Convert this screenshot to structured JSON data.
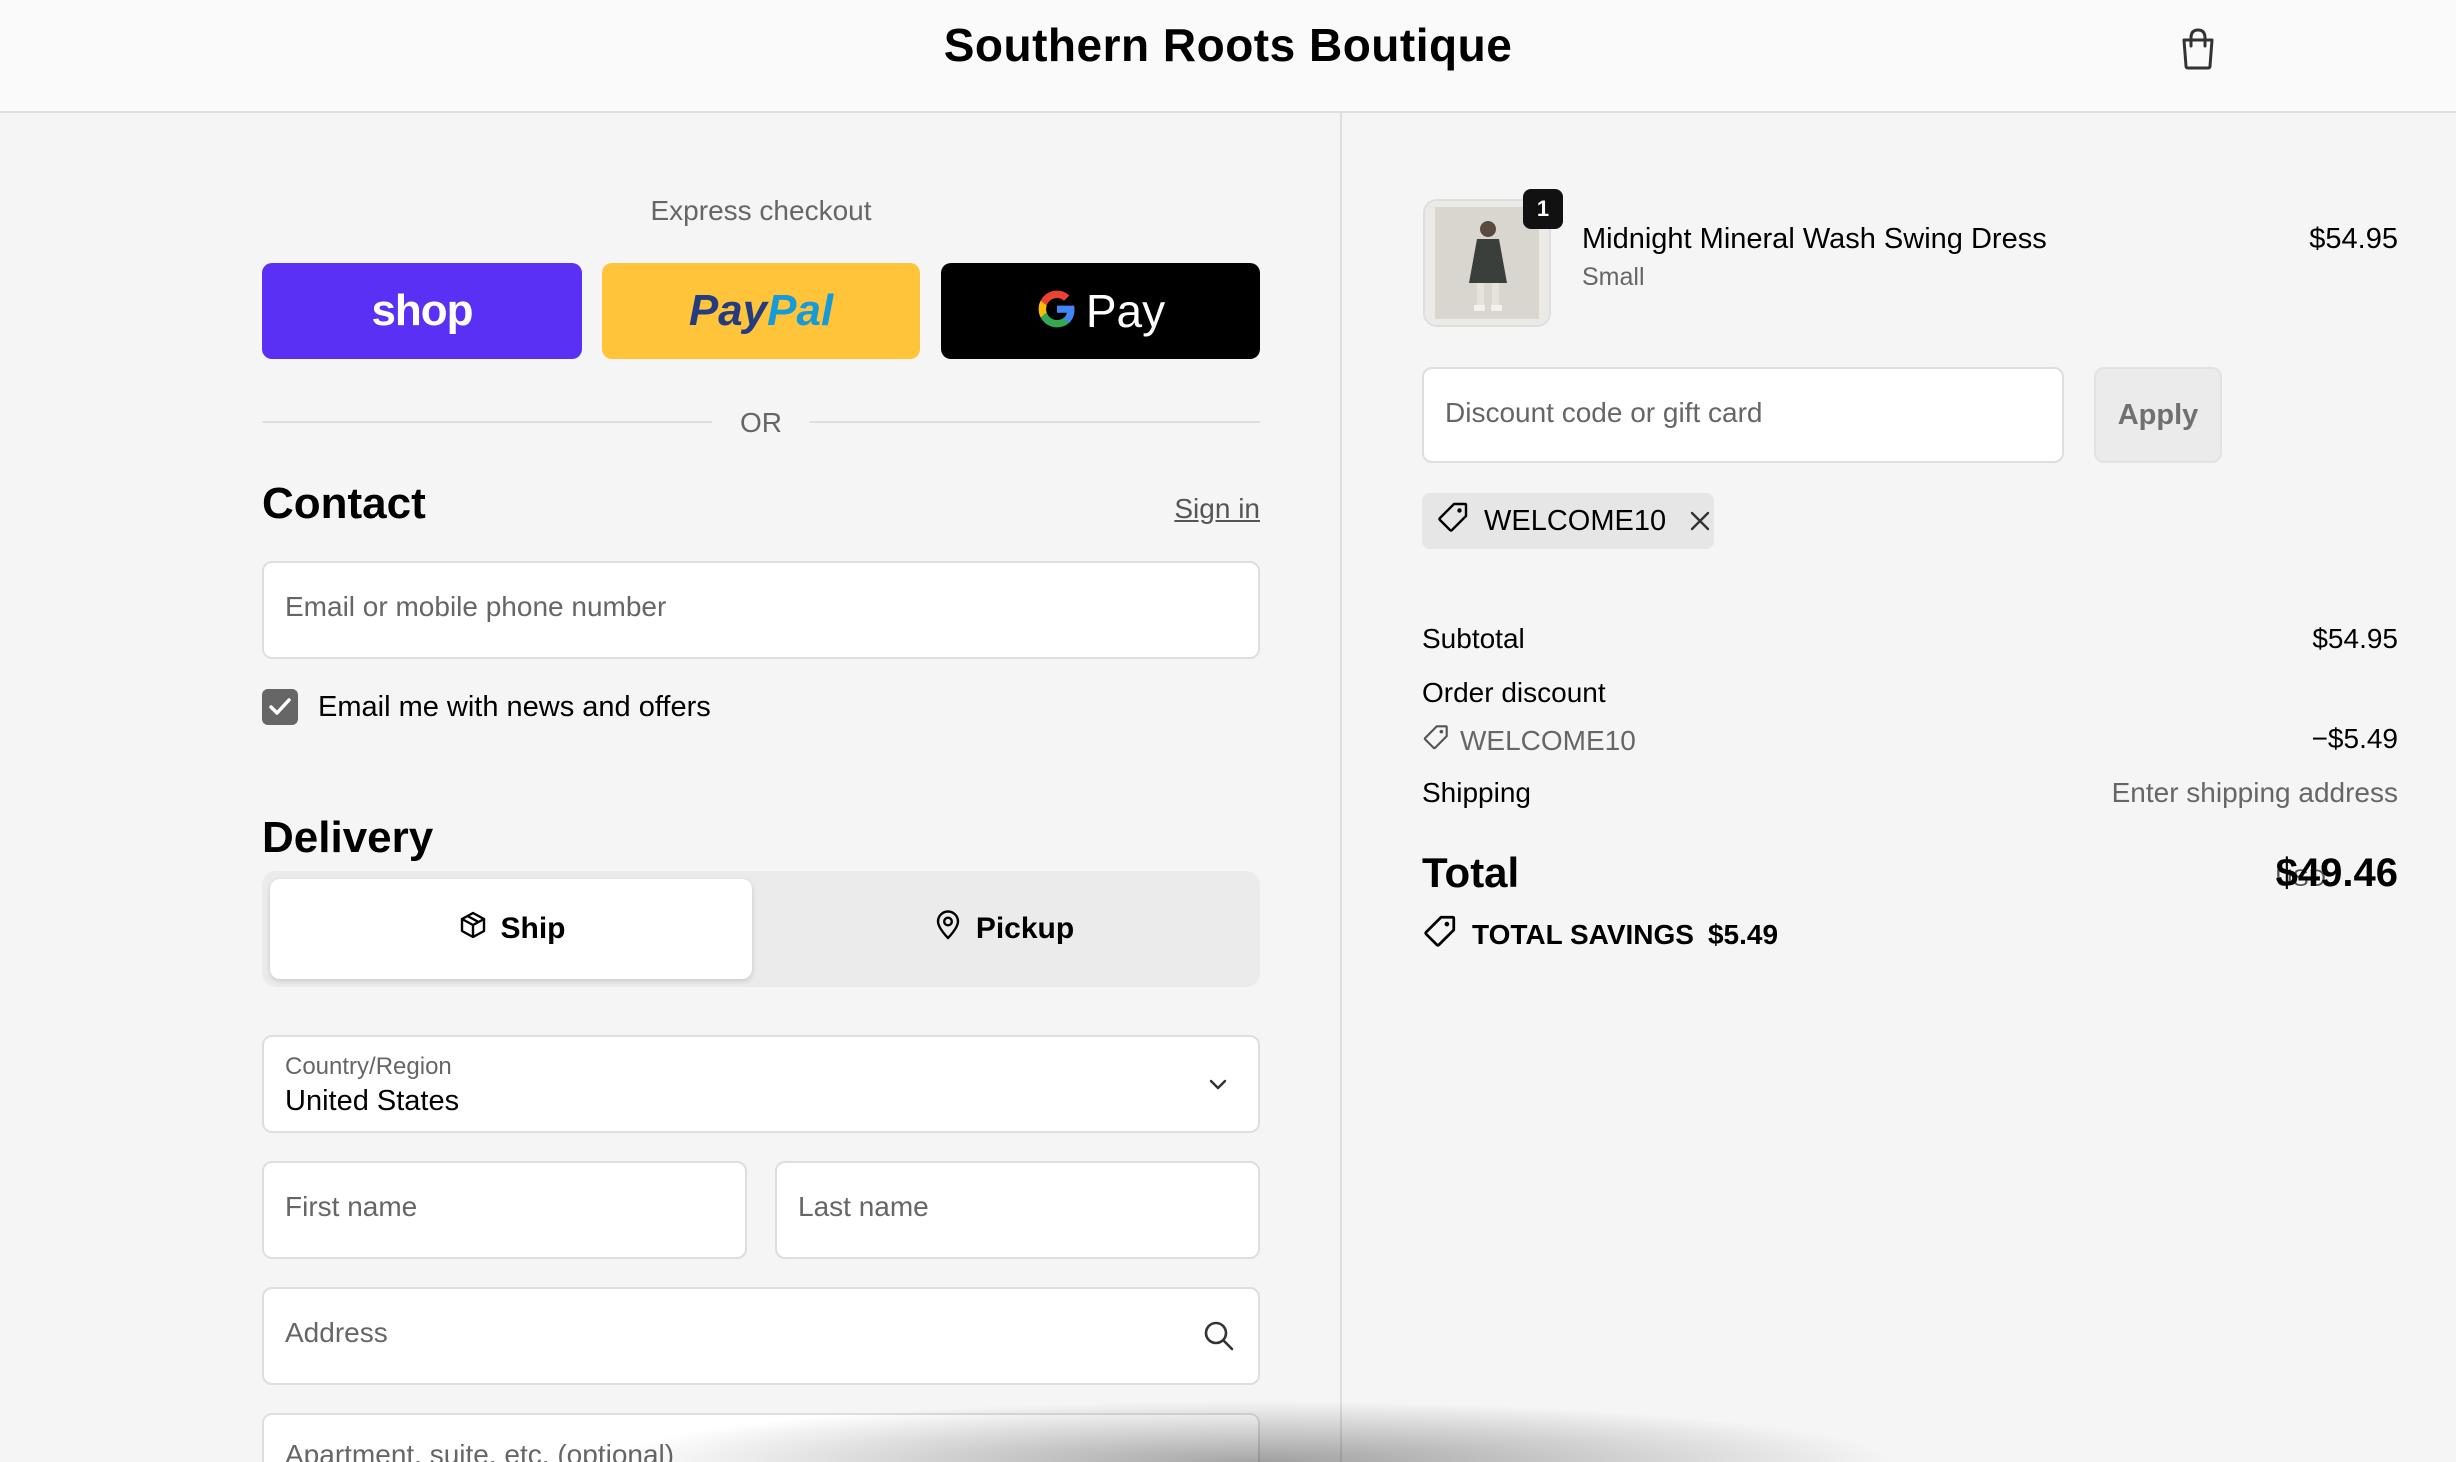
{
  "header": {
    "store_name": "Southern Roots Boutique",
    "cart_icon": "shopping-bag-icon"
  },
  "express": {
    "title": "Express checkout",
    "shop_label": "shop",
    "paypal_label_a": "Pay",
    "paypal_label_b": "Pal",
    "gpay_label": "Pay",
    "or_text": "OR",
    "colors": {
      "shop": "#5a31f4",
      "paypal": "#ffc43a",
      "gpay": "#000000"
    }
  },
  "contact": {
    "title": "Contact",
    "sign_in": "Sign in",
    "email_placeholder": "Email or mobile phone number",
    "news_checkbox_label": "Email me with news and offers",
    "news_checked": true
  },
  "delivery": {
    "title": "Delivery",
    "options": {
      "ship": "Ship",
      "pickup": "Pickup"
    },
    "selected": "Ship",
    "country_label": "Country/Region",
    "country_value": "United States",
    "first_name_placeholder": "First name",
    "last_name_placeholder": "Last name",
    "address_placeholder": "Address",
    "apartment_placeholder": "Apartment, suite, etc. (optional)"
  },
  "summary": {
    "item": {
      "name": "Midnight Mineral Wash Swing Dress",
      "variant": "Small",
      "price": "$54.95",
      "quantity": "1"
    },
    "discount_placeholder": "Discount code or gift card",
    "apply_label": "Apply",
    "applied_code": "WELCOME10",
    "subtotal_label": "Subtotal",
    "subtotal_value": "$54.95",
    "order_discount_label": "Order discount",
    "order_discount_code": "WELCOME10",
    "order_discount_value": "−$5.49",
    "shipping_label": "Shipping",
    "shipping_value": "Enter shipping address",
    "total_label": "Total",
    "total_currency": "USD",
    "total_value": "$49.46",
    "savings_label": "TOTAL SAVINGS",
    "savings_value": "$5.49"
  }
}
